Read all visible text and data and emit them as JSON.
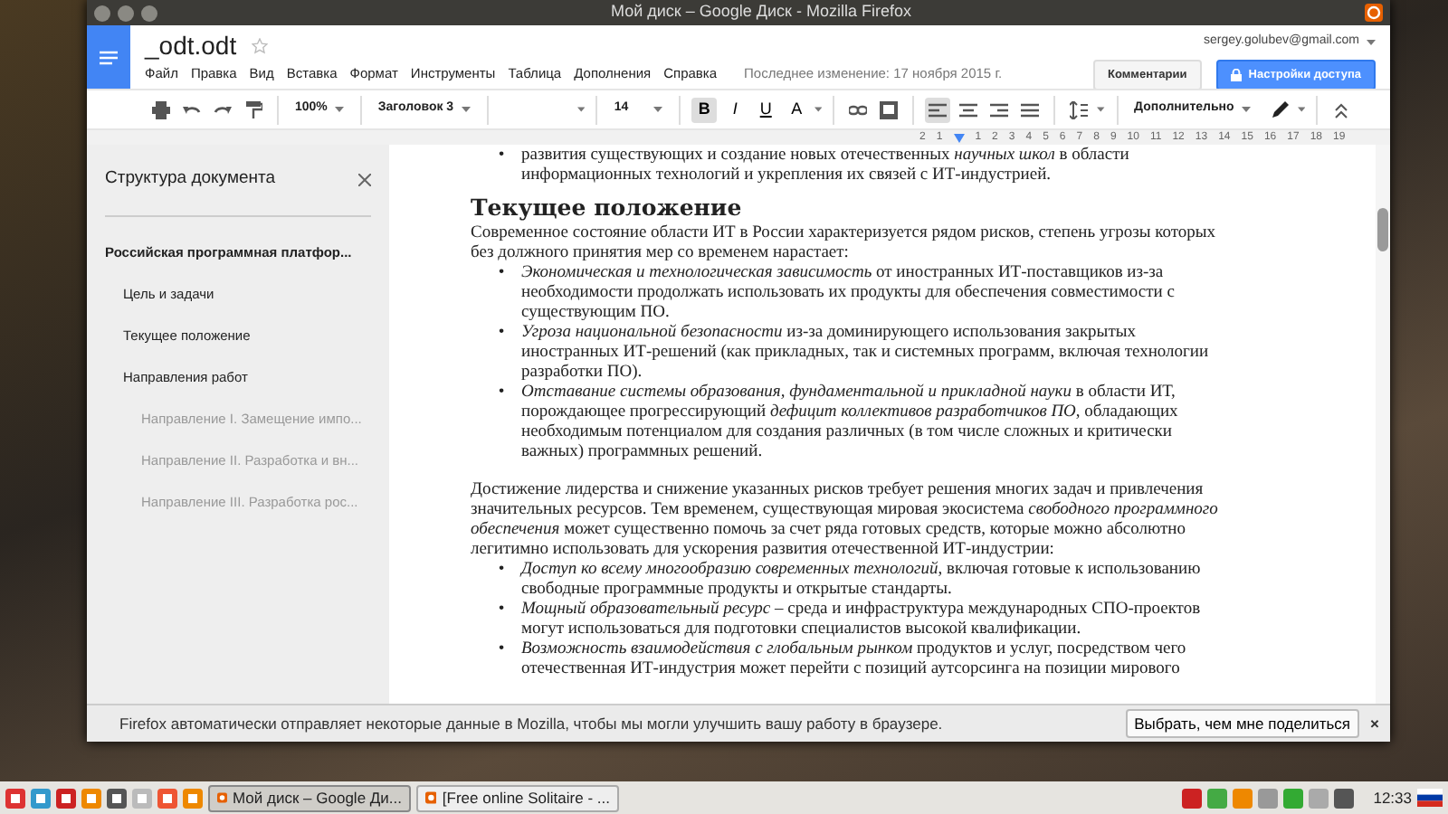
{
  "window": {
    "title": "Мой диск – Google Диск - Mozilla Firefox"
  },
  "docs": {
    "file_name": "_odt.odt",
    "starred": false,
    "account": "sergey.golubev@gmail.com",
    "last_edit": "Последнее изменение: 17 ноября 2015 г.",
    "comments_button": "Комментарии",
    "share_button": "Настройки доступа",
    "menu": [
      "Файл",
      "Правка",
      "Вид",
      "Вставка",
      "Формат",
      "Инструменты",
      "Таблица",
      "Дополнения",
      "Справка"
    ]
  },
  "toolbar": {
    "zoom": "100%",
    "style": "Заголовок 3",
    "font_size": "14",
    "more": "Дополнительно",
    "format_buttons": [
      {
        "kind": "bold",
        "label": "B",
        "on": true
      },
      {
        "kind": "italic",
        "label": "I",
        "on": false
      },
      {
        "kind": "underline",
        "label": "U",
        "on": false
      },
      {
        "kind": "color",
        "label": "A",
        "on": false
      }
    ],
    "alignments": [
      {
        "kind": "left",
        "selected": true
      },
      {
        "kind": "center",
        "selected": false
      },
      {
        "kind": "right",
        "selected": false
      },
      {
        "kind": "justify",
        "selected": false
      }
    ]
  },
  "ruler": [
    "2",
    "1",
    "1",
    "2",
    "3",
    "4",
    "5",
    "6",
    "7",
    "8",
    "9",
    "10",
    "11",
    "12",
    "13",
    "14",
    "15",
    "16",
    "17",
    "18",
    "19"
  ],
  "outline": {
    "title": "Структура документа",
    "items": [
      {
        "label": "Российская программная платфор...",
        "children": [
          {
            "label": "Цель и задачи"
          },
          {
            "label": "Текущее положение"
          },
          {
            "label": "Направления работ",
            "children": [
              {
                "label": "Направление I. Замещение импо..."
              },
              {
                "label": "Направление II. Разработка и вн..."
              },
              {
                "label": "Направление III. Разработка рос..."
              }
            ]
          }
        ]
      }
    ]
  },
  "document": [
    {
      "kind": "bullets",
      "marker": "•",
      "items": [
        "развития существующих и создание новых отечественных *научных школ* в области информационных технологий и укрепления их связей с ИТ-индустрией."
      ]
    },
    {
      "kind": "heading",
      "text": "Текущее положение"
    },
    {
      "kind": "paragraph",
      "text": "Современное состояние области ИТ в России характеризуется рядом рисков, степень угрозы которых без должного принятия мер со временем нарастает:"
    },
    {
      "kind": "bullets",
      "marker": "•",
      "items": [
        "*Экономическая и технологическая зависимость* от иностранных ИТ-поставщиков из-за необходимости продолжать использовать их продукты для обеспечения совместимости с существующим ПО.",
        "*Угроза национальной безопасности* из-за доминирующего использования закрытых иностранных ИТ-решений (как прикладных, так и системных программ, включая технологии разработки ПО).",
        "*Отставание системы образования, фундаментальной и прикладной науки* в области ИТ, порождающее прогрессирующий *дефицит коллективов разработчиков ПО*, обладающих необходимым потенциалом для создания различных (в том числе сложных и критически важных) программных решений."
      ]
    },
    {
      "kind": "paragraph",
      "text": "Достижение лидерства и снижение указанных рисков требует решения многих задач и привлечения значительных ресурсов. Тем временем, существующая мировая экосистема *свободного программного обеспечения* может существенно помочь за счет ряда готовых средств, которые можно абсолютно легитимно использовать для ускорения развития отечественной ИТ-индустрии:"
    },
    {
      "kind": "bullets",
      "marker": "•",
      "items": [
        "*Доступ ко всему многообразию современных технологий*, включая готовые к использованию свободные программные продукты и открытые стандарты.",
        "*Мощный образовательный ресурс* – среда и инфраструктура международных СПО-проектов могут использоваться для подготовки специалистов высокой квалификации.",
        "*Возможность взаимодействия с глобальным рынком* продуктов и услуг, посредством чего отечественная ИТ-индустрия может перейти с позиций аутсорсинга на позиции мирового"
      ]
    }
  ],
  "notification": {
    "text": "Firefox автоматически отправляет некоторые данные в Mozilla, чтобы мы могли улучшить вашу работу в браузере.",
    "button": "Выбрать, чем мне поделиться",
    "close": "×"
  },
  "taskbar": {
    "tasks": [
      {
        "label": "Мой диск – Google Ди...",
        "selected": true
      },
      {
        "label": "[Free online Solitaire - ...",
        "selected": false
      }
    ],
    "clock": "12:33"
  }
}
